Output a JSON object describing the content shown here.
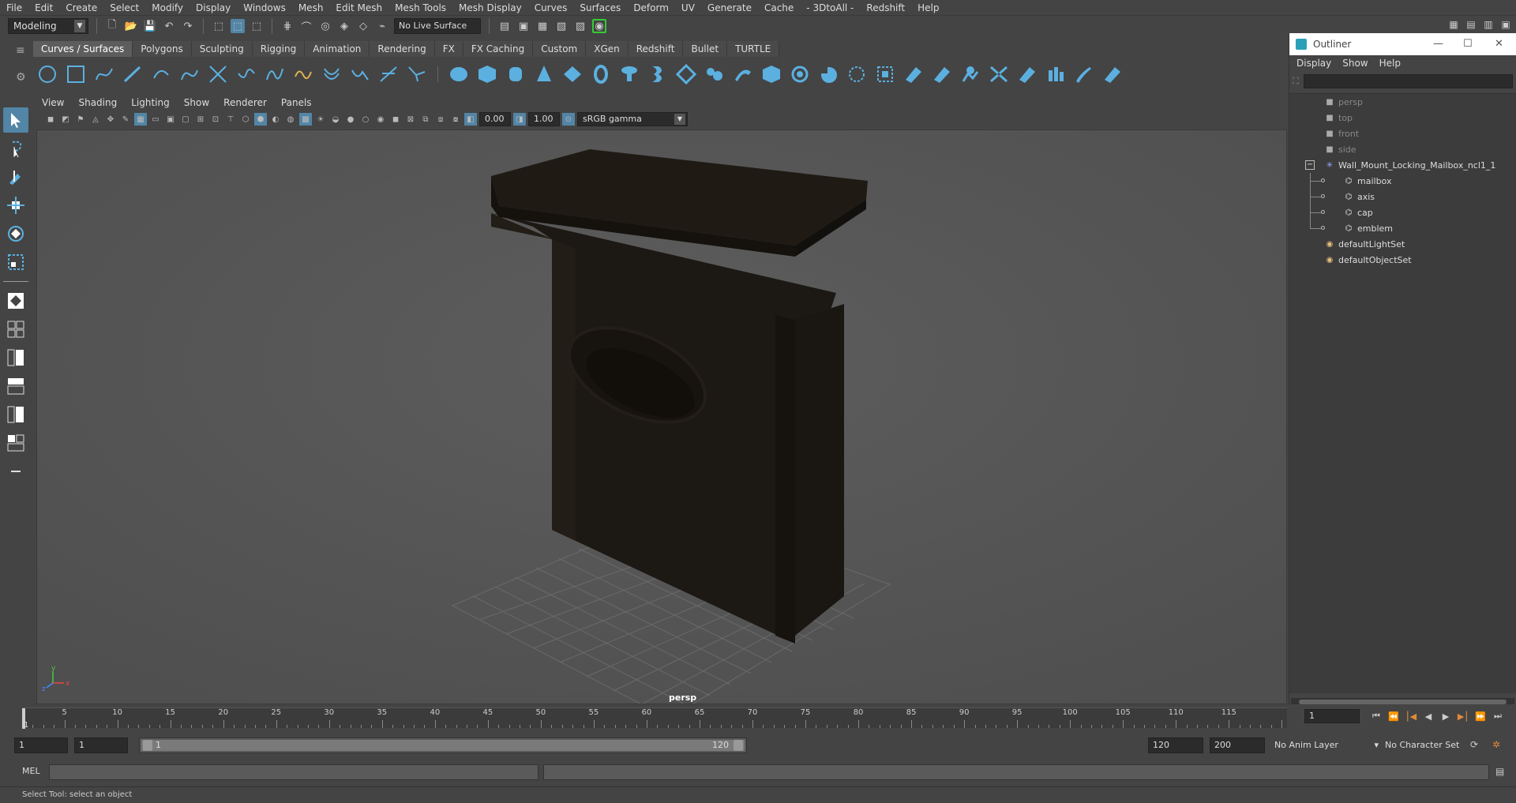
{
  "menubar": [
    "File",
    "Edit",
    "Create",
    "Select",
    "Modify",
    "Display",
    "Windows",
    "Mesh",
    "Edit Mesh",
    "Mesh Tools",
    "Mesh Display",
    "Curves",
    "Surfaces",
    "Deform",
    "UV",
    "Generate",
    "Cache",
    "- 3DtoAll -",
    "Redshift",
    "Help"
  ],
  "statusline": {
    "mode": "Modeling",
    "live_surface": "No Live Surface"
  },
  "shelf_tabs": [
    "Curves / Surfaces",
    "Polygons",
    "Sculpting",
    "Rigging",
    "Animation",
    "Rendering",
    "FX",
    "FX Caching",
    "Custom",
    "XGen",
    "Redshift",
    "Bullet",
    "TURTLE"
  ],
  "panel_menu": [
    "View",
    "Shading",
    "Lighting",
    "Show",
    "Renderer",
    "Panels"
  ],
  "panel_tools": {
    "exposure": "0.00",
    "gamma": "1.00",
    "color_space": "sRGB gamma"
  },
  "viewport": {
    "camera": "persp"
  },
  "outliner": {
    "title": "Outliner",
    "menu": [
      "Display",
      "Show",
      "Help"
    ],
    "items": [
      {
        "label": "persp",
        "type": "camera",
        "dim": true
      },
      {
        "label": "top",
        "type": "camera",
        "dim": true
      },
      {
        "label": "front",
        "type": "camera",
        "dim": true
      },
      {
        "label": "side",
        "type": "camera",
        "dim": true
      },
      {
        "label": "Wall_Mount_Locking_Mailbox_ncl1_1",
        "type": "group",
        "dim": false
      },
      {
        "label": "mailbox",
        "type": "mesh",
        "dim": false
      },
      {
        "label": "axis",
        "type": "mesh",
        "dim": false
      },
      {
        "label": "cap",
        "type": "mesh",
        "dim": false
      },
      {
        "label": "emblem",
        "type": "mesh",
        "dim": false
      },
      {
        "label": "defaultLightSet",
        "type": "set",
        "dim": false
      },
      {
        "label": "defaultObjectSet",
        "type": "set",
        "dim": false
      }
    ]
  },
  "timeslider": {
    "ticks": [
      "5",
      "10",
      "15",
      "20",
      "25",
      "30",
      "35",
      "40",
      "45",
      "50",
      "55",
      "60",
      "65",
      "70",
      "75",
      "80",
      "85",
      "90",
      "95",
      "100",
      "105",
      "110",
      "115"
    ],
    "current_label": "1",
    "current_frame": "1"
  },
  "rangeslider": {
    "start": "1",
    "anim_start": "1",
    "range_start": "1",
    "range_end": "120",
    "end": "120",
    "anim_end": "200",
    "anim_layer": "No Anim Layer",
    "character_set": "No Character Set"
  },
  "commandline": {
    "label": "MEL"
  },
  "helpline": "Select Tool: select an object",
  "colors": {
    "accent": "#5285a6",
    "shelf_icon": "#5bb0e0",
    "mailbox": "#1f1a14"
  }
}
